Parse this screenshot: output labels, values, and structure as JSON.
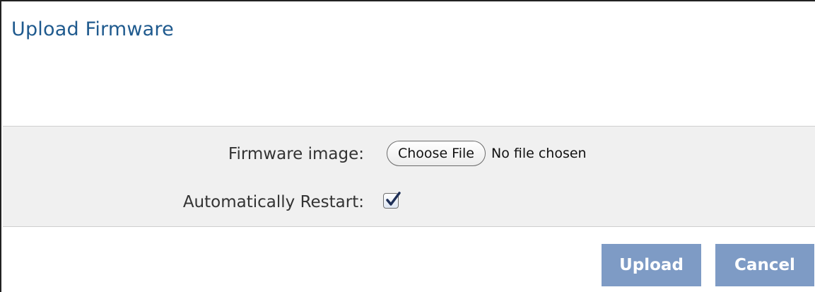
{
  "title": "Upload Firmware",
  "form": {
    "firmware_image": {
      "label": "Firmware image:",
      "button_label": "Choose File",
      "status": "No file chosen"
    },
    "auto_restart": {
      "label": "Automatically Restart:",
      "checked": true
    }
  },
  "actions": {
    "upload_label": "Upload",
    "cancel_label": "Cancel"
  },
  "colors": {
    "title": "#1f5a8e",
    "panel_background": "#f0f0f0",
    "button_background": "#7e9bc5",
    "button_text": "#ffffff"
  }
}
